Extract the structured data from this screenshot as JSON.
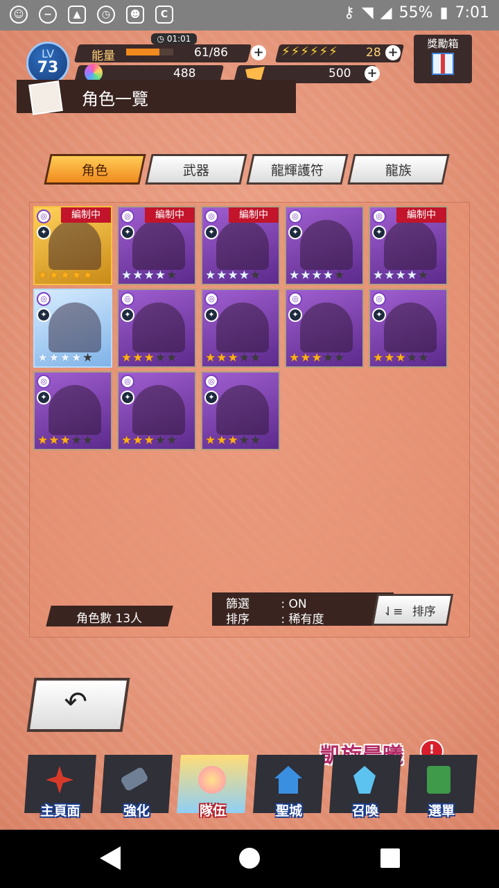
{
  "status_bar": {
    "battery": "55%",
    "time": "7:01"
  },
  "hud": {
    "level_label": "LV",
    "level": "73",
    "energy_label": "能量",
    "energy_timer": "01:01",
    "energy": "61/86",
    "energy_fill": 0.71,
    "stamina": "28",
    "gems": "488",
    "tickets": "500",
    "reward_box": "獎勵箱"
  },
  "page_title": "角色一覽",
  "tabs": [
    {
      "label": "角色",
      "active": true
    },
    {
      "label": "武器",
      "active": false
    },
    {
      "label": "龍輝護符",
      "active": false
    },
    {
      "label": "龍族",
      "active": false
    }
  ],
  "characters": [
    {
      "frame": "gold",
      "stars": 5,
      "star_type": "gold",
      "formed": true,
      "weapon": "劍"
    },
    {
      "frame": "purple",
      "stars": 4,
      "star_type": "blue",
      "formed": true,
      "weapon": "劍"
    },
    {
      "frame": "purple",
      "stars": 4,
      "star_type": "blue",
      "formed": true,
      "weapon": "斧"
    },
    {
      "frame": "purple",
      "stars": 4,
      "star_type": "blue",
      "formed": false,
      "weapon": "槍"
    },
    {
      "frame": "purple",
      "stars": 4,
      "star_type": "blue",
      "formed": true,
      "weapon": "杖"
    },
    {
      "frame": "blue",
      "stars": 4,
      "star_type": "blue",
      "formed": false,
      "weapon": "杖"
    },
    {
      "frame": "purple",
      "stars": 3,
      "star_type": "gold",
      "formed": false,
      "weapon": "劍"
    },
    {
      "frame": "purple",
      "stars": 3,
      "star_type": "gold",
      "formed": false,
      "weapon": "劍"
    },
    {
      "frame": "purple",
      "stars": 3,
      "star_type": "gold",
      "formed": false,
      "weapon": "劍"
    },
    {
      "frame": "purple",
      "stars": 3,
      "star_type": "gold",
      "formed": false,
      "weapon": "斧"
    },
    {
      "frame": "purple",
      "stars": 3,
      "star_type": "gold",
      "formed": false,
      "weapon": "槍"
    },
    {
      "frame": "purple",
      "stars": 3,
      "star_type": "gold",
      "formed": false,
      "weapon": "杖"
    },
    {
      "frame": "purple",
      "stars": 3,
      "star_type": "gold",
      "formed": false,
      "weapon": "杖"
    }
  ],
  "formed_label": "編制中",
  "count_label": "角色數 13人",
  "filter": {
    "filter_label": "篩選",
    "filter_value": ": ON",
    "sort_label": "排序",
    "sort_value": ": 稀有度"
  },
  "sort_button": "排序",
  "nav": [
    {
      "label": "主頁面",
      "active": false
    },
    {
      "label": "強化",
      "active": false
    },
    {
      "label": "隊伍",
      "active": true
    },
    {
      "label": "聖城",
      "active": false
    },
    {
      "label": "召喚",
      "active": false
    },
    {
      "label": "選單",
      "active": false
    }
  ],
  "promo_text": "凱旋晨曦",
  "alert_text": "!",
  "colors": {
    "accent": "#f08a1f",
    "formed": "#c2142a",
    "background": "#e59579"
  }
}
